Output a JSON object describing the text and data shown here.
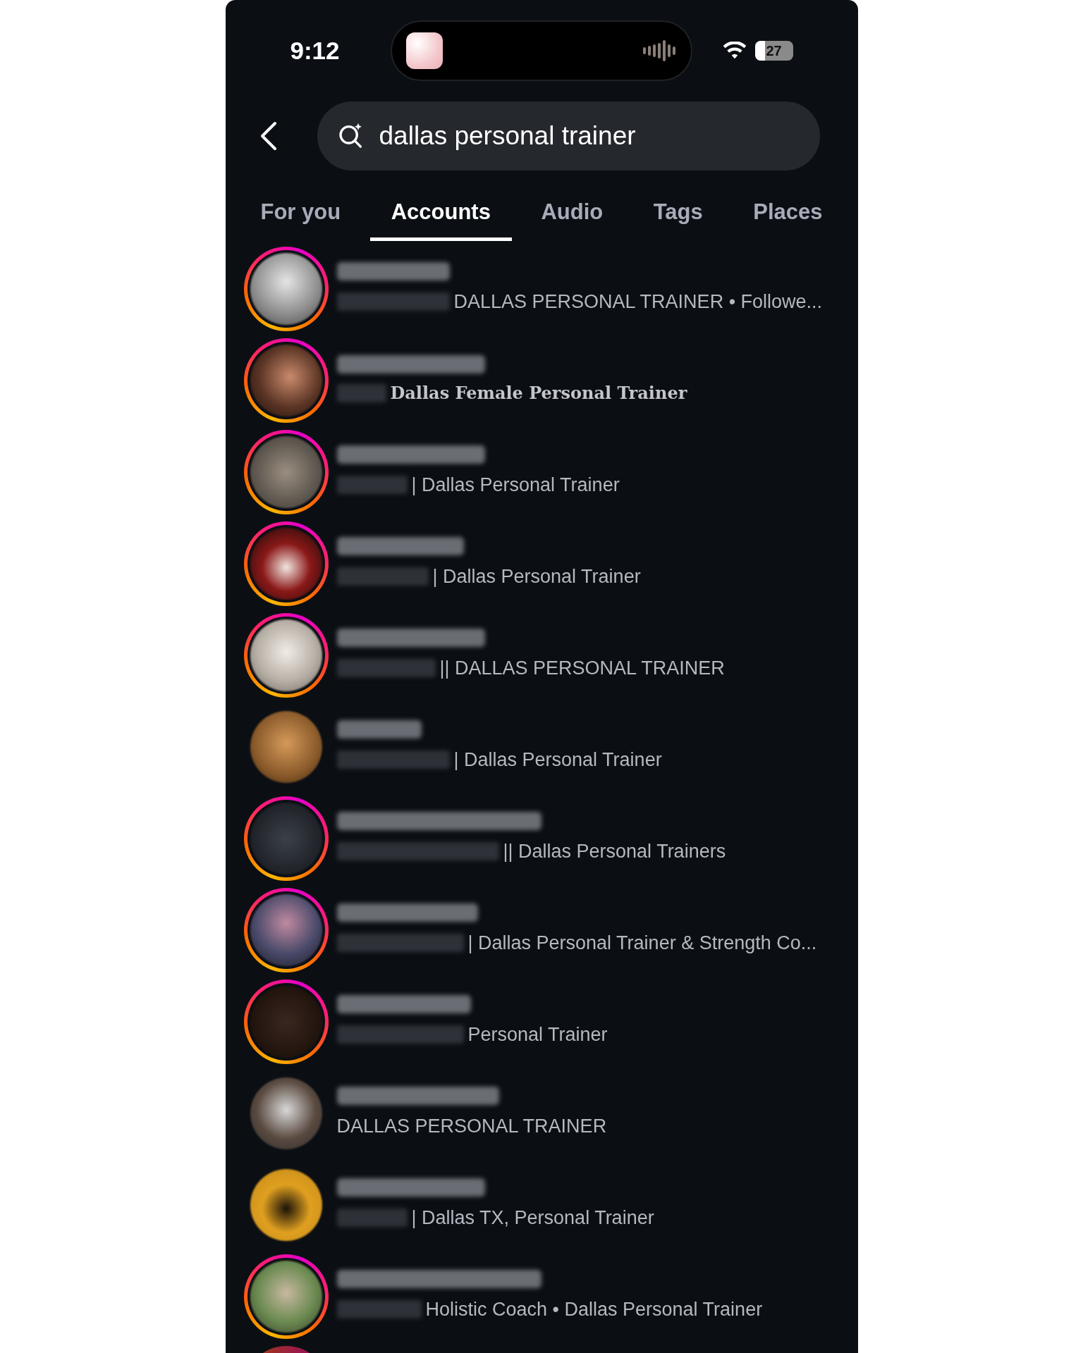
{
  "status_bar": {
    "time": "9:12",
    "battery": "27"
  },
  "search": {
    "value": "dallas personal trainer"
  },
  "tabs": [
    {
      "label": "For you",
      "selected": false
    },
    {
      "label": "Accounts",
      "selected": true
    },
    {
      "label": "Audio",
      "selected": false
    },
    {
      "label": "Tags",
      "selected": false
    },
    {
      "label": "Places",
      "selected": false
    }
  ],
  "accounts": [
    {
      "story_ring": true,
      "bio": "DALLAS PERSONAL TRAINER • Followe...",
      "kind": "plain"
    },
    {
      "story_ring": true,
      "bio": "Dallas Female Personal Trainer",
      "kind": "serif"
    },
    {
      "story_ring": true,
      "bio": "| Dallas Personal Trainer",
      "kind": "plain"
    },
    {
      "story_ring": true,
      "bio": "| Dallas Personal Trainer",
      "kind": "plain"
    },
    {
      "story_ring": true,
      "bio": "|| DALLAS PERSONAL TRAINER",
      "kind": "plain"
    },
    {
      "story_ring": false,
      "bio": "| Dallas Personal Trainer",
      "kind": "plain"
    },
    {
      "story_ring": true,
      "bio": "|| Dallas Personal Trainers",
      "kind": "plain"
    },
    {
      "story_ring": true,
      "bio": "| Dallas Personal Trainer & Strength Co...",
      "kind": "plain"
    },
    {
      "story_ring": true,
      "bio": "Personal Trainer",
      "kind": "plain"
    },
    {
      "story_ring": false,
      "bio": "DALLAS PERSONAL TRAINER",
      "kind": "plain"
    },
    {
      "story_ring": false,
      "bio": "| Dallas TX, Personal Trainer",
      "kind": "plain"
    },
    {
      "story_ring": true,
      "bio": "Holistic Coach • Dallas Personal Trainer",
      "kind": "plain"
    }
  ]
}
